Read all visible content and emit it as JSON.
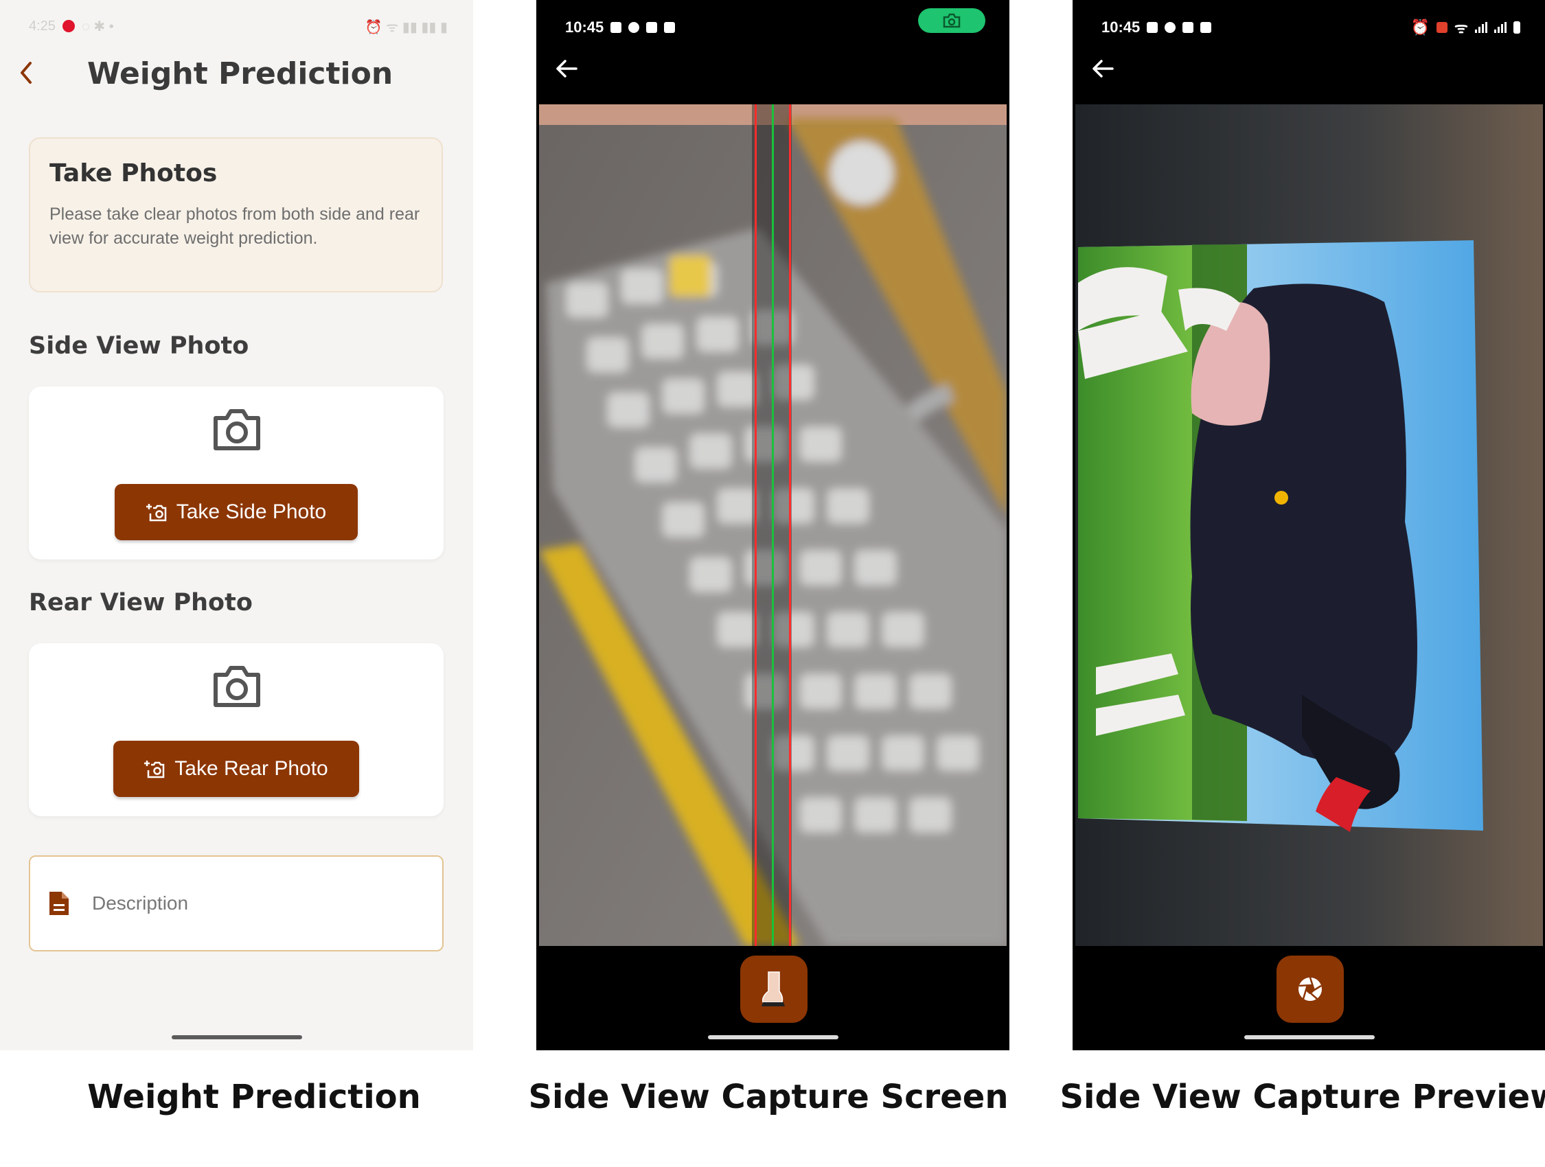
{
  "screens": [
    {
      "status_time": "4:25",
      "header": {
        "title": "Weight Prediction"
      },
      "info_card": {
        "title": "Take Photos",
        "text": "Please take clear photos from both side and rear view for accurate weight prediction."
      },
      "side_section": {
        "title": "Side View Photo",
        "button_label": "Take Side Photo"
      },
      "rear_section": {
        "title": "Rear View Photo",
        "button_label": "Take Rear Photo"
      },
      "description": {
        "placeholder": "Description",
        "icon": "document-icon"
      },
      "caption": "Weight Prediction"
    },
    {
      "status_time": "10:45",
      "caption": "Side View Capture Screen",
      "guide_lines": [
        "red",
        "green",
        "red"
      ],
      "shutter_icon": "leg-icon"
    },
    {
      "status_time": "10:45",
      "caption": "Side View Capture Preview",
      "shutter_icon": "aperture-icon"
    }
  ],
  "colors": {
    "accent": "#8c3604",
    "app_background": "#f5f4f2",
    "info_background": "#f7f1e8",
    "capture_pill": "#1ec46f",
    "guide_red": "#ff2d2d",
    "guide_green": "#18c23a",
    "marker_dot": "#f0b400"
  }
}
